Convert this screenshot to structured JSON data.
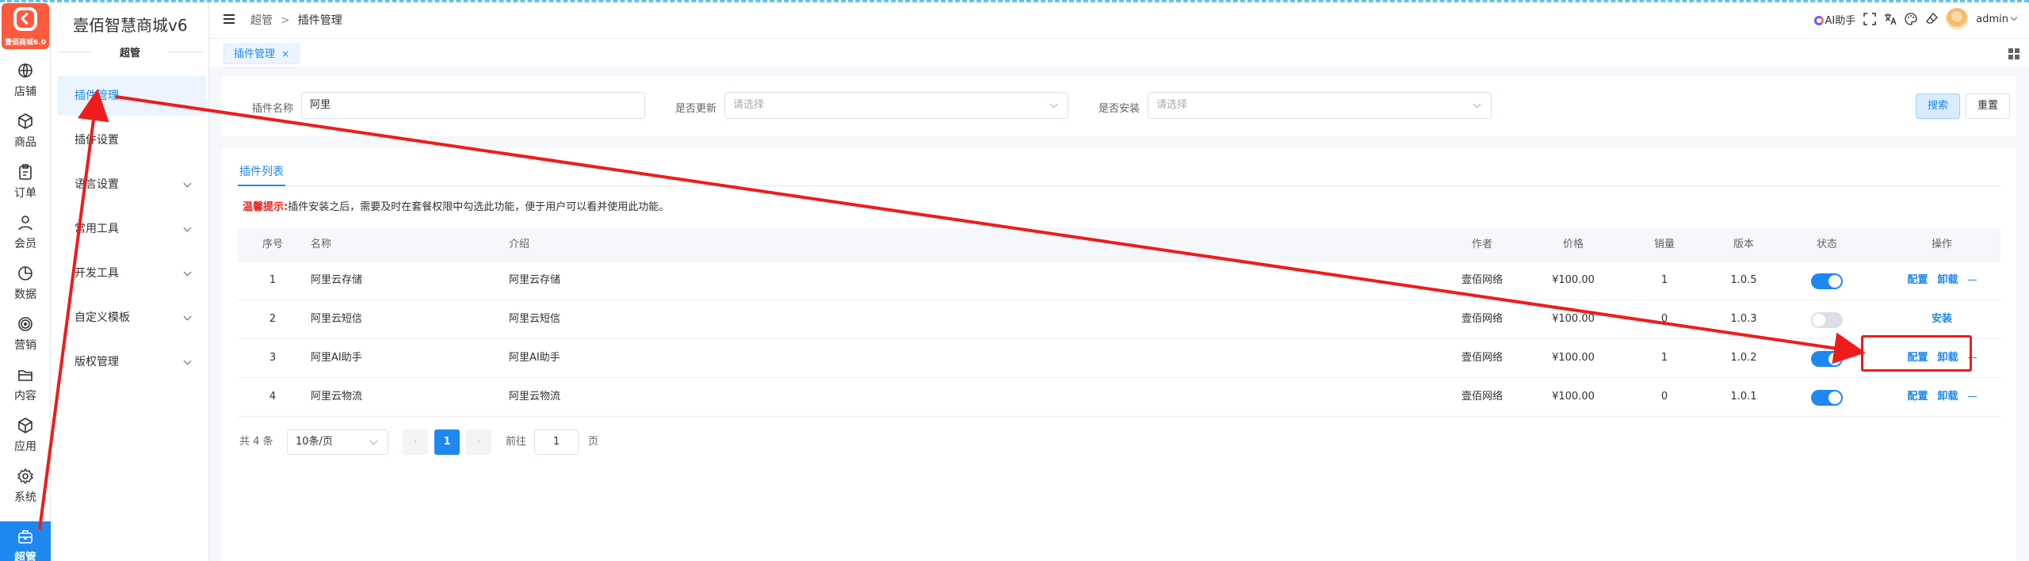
{
  "brand": {
    "logo_text": "壹佰商城6.0",
    "name": "壹佰智慧商城v6",
    "section": "超管"
  },
  "rail": [
    {
      "label": "店铺",
      "icon": "globe-icon"
    },
    {
      "label": "商品",
      "icon": "cube-icon"
    },
    {
      "label": "订单",
      "icon": "clipboard-icon"
    },
    {
      "label": "会员",
      "icon": "user-icon"
    },
    {
      "label": "数据",
      "icon": "pie-chart-icon"
    },
    {
      "label": "营销",
      "icon": "target-icon"
    },
    {
      "label": "内容",
      "icon": "folder-icon"
    },
    {
      "label": "应用",
      "icon": "box-icon"
    },
    {
      "label": "系统",
      "icon": "gear-icon"
    },
    {
      "label": "超管",
      "icon": "briefcase-icon",
      "active": true
    }
  ],
  "menu": [
    {
      "label": "插件管理",
      "active": true,
      "expandable": false
    },
    {
      "label": "插件设置",
      "active": false,
      "expandable": false
    },
    {
      "label": "语言设置",
      "active": false,
      "expandable": true
    },
    {
      "label": "常用工具",
      "active": false,
      "expandable": true
    },
    {
      "label": "开发工具",
      "active": false,
      "expandable": true
    },
    {
      "label": "自定义模板",
      "active": false,
      "expandable": true
    },
    {
      "label": "版权管理",
      "active": false,
      "expandable": true
    }
  ],
  "header": {
    "breadcrumb": [
      "超管",
      "插件管理"
    ],
    "separator": ">",
    "ai_label": "AI助手",
    "user": "admin"
  },
  "tabs": [
    {
      "label": "插件管理",
      "close": "×"
    }
  ],
  "filter": {
    "name_label": "插件名称",
    "name_value": "阿里",
    "update_label": "是否更新",
    "update_placeholder": "请选择",
    "install_label": "是否安装",
    "install_placeholder": "请选择",
    "search_btn": "搜索",
    "reset_btn": "重置"
  },
  "list": {
    "tab": "插件列表",
    "tip_key": "温馨提示:",
    "tip_text": "插件安装之后，需要及时在套餐权限中勾选此功能，便于用户可以看并使用此功能。",
    "columns": [
      "序号",
      "名称",
      "介绍",
      "作者",
      "价格",
      "销量",
      "版本",
      "状态",
      "操作"
    ],
    "rows": [
      {
        "no": "1",
        "name": "阿里云存储",
        "intro": "阿里云存储",
        "author": "壹佰网络",
        "price": "¥100.00",
        "sales": "1",
        "version": "1.0.5",
        "enabled": true,
        "actions": [
          "配置",
          "卸载",
          "---"
        ]
      },
      {
        "no": "2",
        "name": "阿里云短信",
        "intro": "阿里云短信",
        "author": "壹佰网络",
        "price": "¥100.00",
        "sales": "0",
        "version": "1.0.3",
        "enabled": false,
        "actions": [
          "安装"
        ]
      },
      {
        "no": "3",
        "name": "阿里AI助手",
        "intro": "阿里AI助手",
        "author": "壹佰网络",
        "price": "¥100.00",
        "sales": "1",
        "version": "1.0.2",
        "enabled": true,
        "actions": [
          "配置",
          "卸载",
          "---"
        ]
      },
      {
        "no": "4",
        "name": "阿里云物流",
        "intro": "阿里云物流",
        "author": "壹佰网络",
        "price": "¥100.00",
        "sales": "0",
        "version": "1.0.1",
        "enabled": true,
        "actions": [
          "配置",
          "卸载",
          "---"
        ]
      }
    ]
  },
  "pagination": {
    "total": "共 4 条",
    "page_size": "10条/页",
    "prev": "‹",
    "next": "›",
    "current": "1",
    "goto_label": "前往",
    "goto_value": "1",
    "page_suffix": "页"
  },
  "colors": {
    "primary": "#1e88f0",
    "logo": "#ff5a3d",
    "annotation": "#ee1c1c",
    "warning_text": "#f01e1e"
  }
}
